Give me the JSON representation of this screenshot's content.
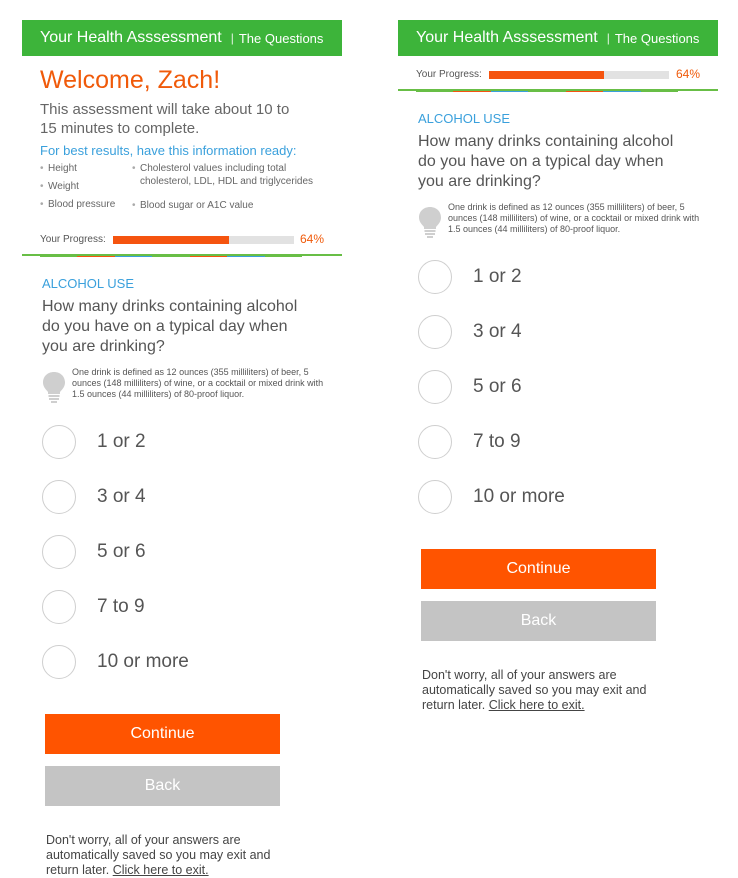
{
  "header": {
    "title": "Your Health Asssessment",
    "separator": "|",
    "subtitle": "The Questions"
  },
  "welcome": {
    "greeting": "Welcome, Zach!",
    "intro": "This assessment will take about 10 to 15 minutes to complete.",
    "ready_text": "For best results, have this information ready:",
    "checklist_col1": [
      "Height",
      "Weight",
      "Blood pressure"
    ],
    "checklist_col2": [
      "Cholesterol values including total cholesterol, LDL, HDL and triglycerides",
      "Blood sugar or A1C value"
    ]
  },
  "progress": {
    "label": "Your Progress:",
    "value_text": "64%",
    "value": 0.64
  },
  "question": {
    "category": "ALCOHOL USE",
    "text": "How many drinks containing alcohol do you have on a typical day when you are drinking?",
    "tip": "One drink is defined as 12 ounces (355 milliliters) of beer, 5 ounces (148 milliliters) of wine, or a cocktail or mixed drink with 1.5 ounces (44 milliliters) of 80-proof liquor.",
    "tip_icon": "lightbulb-icon",
    "options": [
      "1 or 2",
      "3 or 4",
      "5 or 6",
      "7 to 9",
      "10 or more"
    ]
  },
  "buttons": {
    "continue": "Continue",
    "back": "Back"
  },
  "footer": {
    "text": "Don't worry, all of your answers are automatically saved so you may exit and return later.",
    "link": "Click here to exit."
  },
  "colors": {
    "brand_green": "#3db43a",
    "accent_orange": "#f05a0a",
    "button_orange": "#ff5400",
    "info_blue": "#3aa0dc",
    "back_gray": "#c4c4c4",
    "progress_track": "#e2e2e2"
  },
  "stripe_colors": [
    "#68be46",
    "#f5540f",
    "#3aa0dc",
    "#68be46",
    "#f5540f",
    "#3aa0dc",
    "#68be46"
  ]
}
